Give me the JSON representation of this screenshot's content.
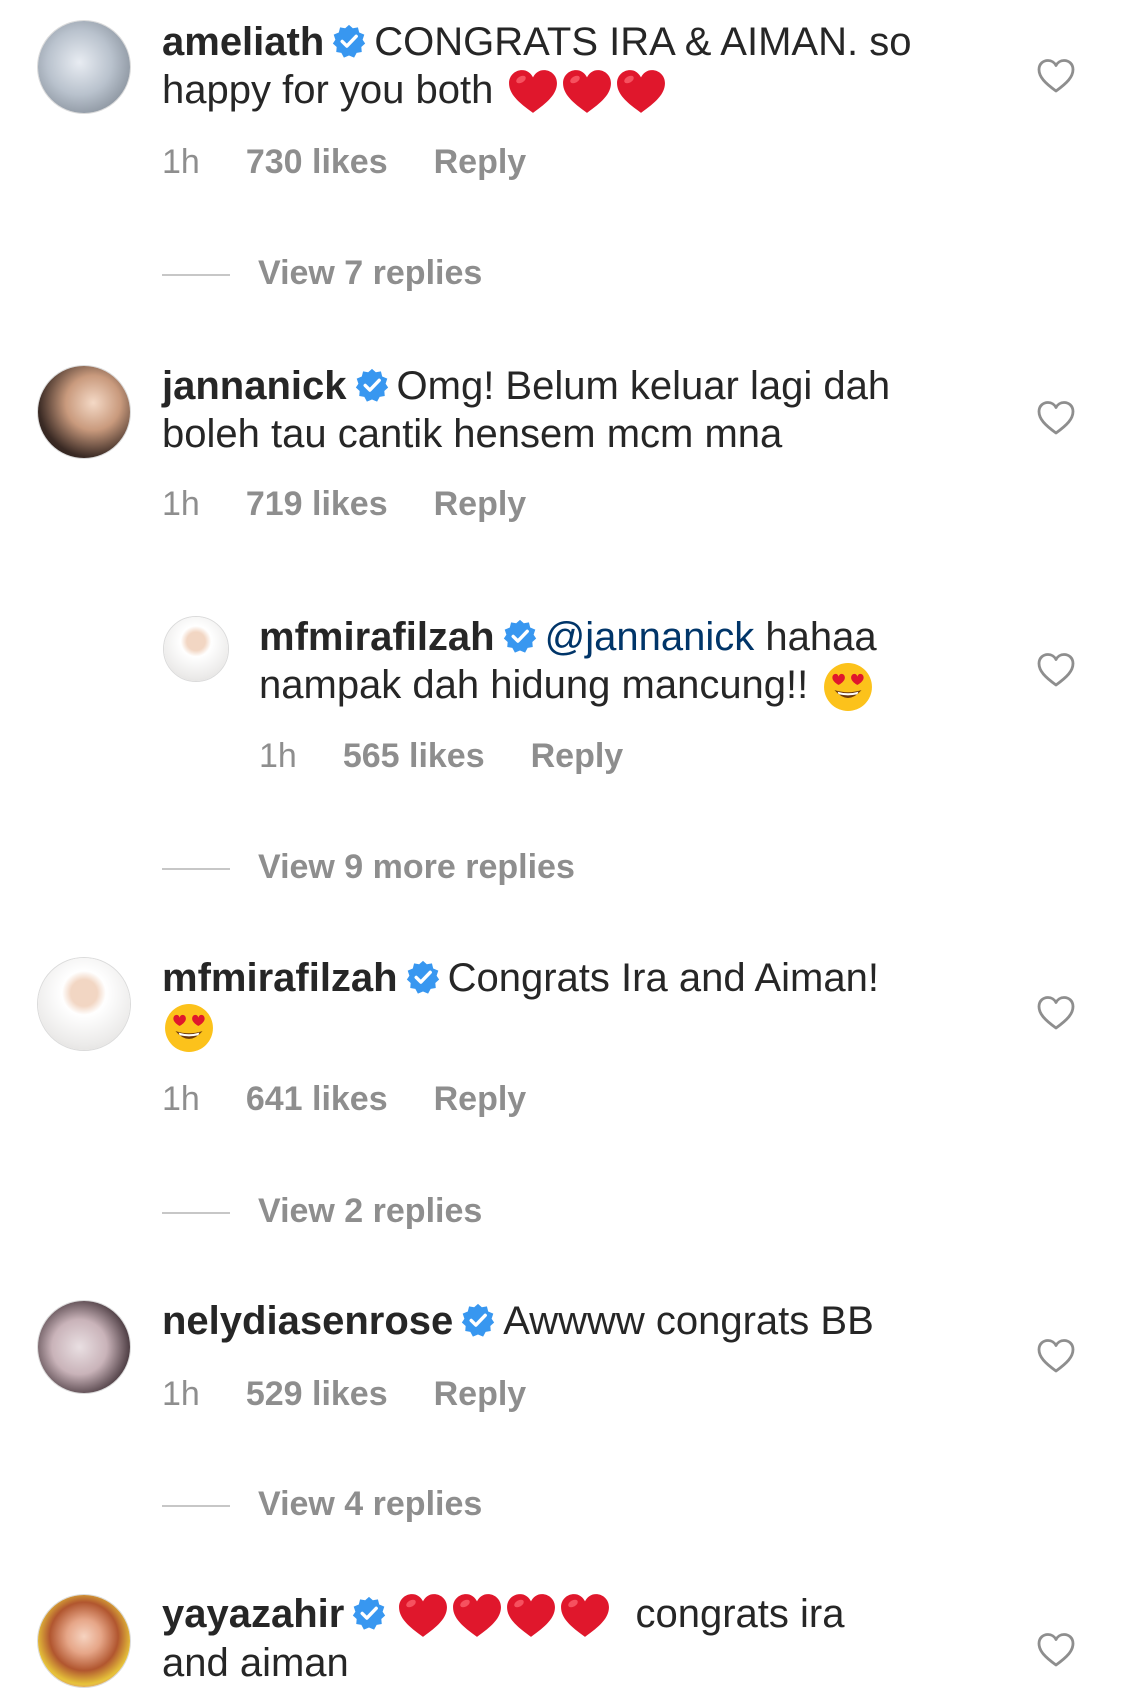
{
  "comments": [
    {
      "username": "ameliath",
      "text": "CONGRATS IRA & AIMAN. so happy for you both",
      "hearts": 3,
      "time": "1h",
      "likes": "730 likes",
      "reply": "Reply",
      "view_replies": "View 7 replies"
    },
    {
      "username": "jannanick",
      "text": "Omg! Belum keluar lagi dah boleh tau cantik hensem mcm mna",
      "time": "1h",
      "likes": "719 likes",
      "reply": "Reply"
    },
    {
      "username": "mfmirafilzah",
      "mention": "@jannanick",
      "text": "hahaa nampak dah hidung mancung!!",
      "emoji": "heart-eyes",
      "time": "1h",
      "likes": "565 likes",
      "reply": "Reply",
      "view_replies": "View 9 more replies"
    },
    {
      "username": "mfmirafilzah",
      "text": "Congrats Ira and Aiman!",
      "emoji": "heart-eyes",
      "time": "1h",
      "likes": "641 likes",
      "reply": "Reply",
      "view_replies": "View 2 replies"
    },
    {
      "username": "nelydiasenrose",
      "text": "Awwww congrats BB",
      "time": "1h",
      "likes": "529 likes",
      "reply": "Reply",
      "view_replies": "View 4 replies"
    },
    {
      "username": "yayazahir",
      "hearts": 4,
      "text_line1": "congrats ira",
      "text_line2": "and aiman"
    }
  ],
  "colors": {
    "verified": "#3897f0",
    "heart_emoji": "#e0172c",
    "meta": "#8e8e8e",
    "mention": "#003569"
  },
  "icons": {
    "verified": "verified-badge-icon",
    "like": "heart-outline-icon"
  }
}
